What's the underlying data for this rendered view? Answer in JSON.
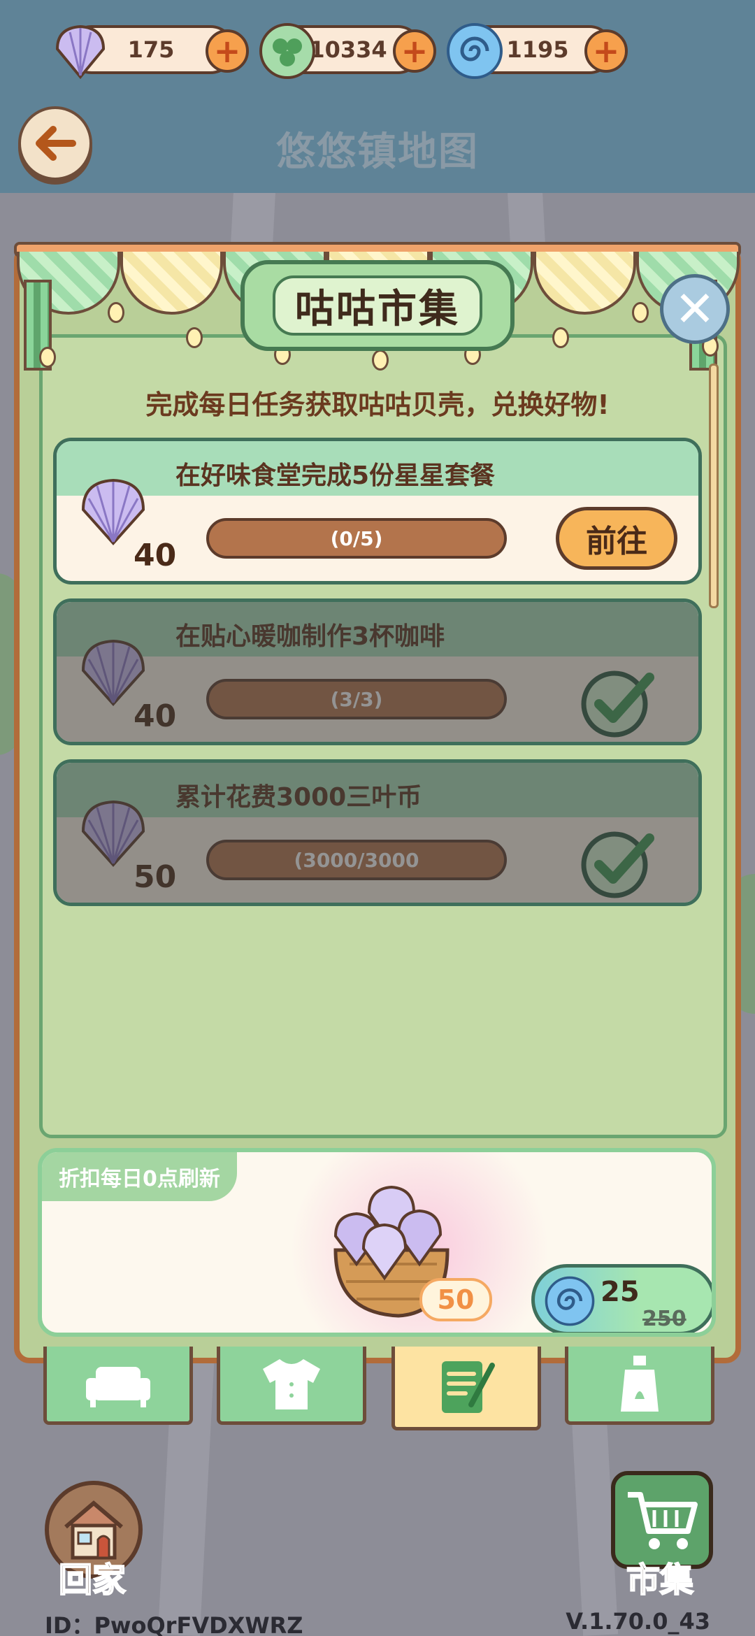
{
  "currencies": [
    {
      "name": "shell",
      "amount": "175",
      "icon": "shell-icon"
    },
    {
      "name": "clover",
      "amount": "10334",
      "icon": "clover-icon"
    },
    {
      "name": "swirl",
      "amount": "1195",
      "icon": "swirl-icon"
    }
  ],
  "header": {
    "map_title": "悠悠镇地图"
  },
  "market": {
    "title": "咕咕市集",
    "subtitle": "完成每日任务获取咕咕贝壳，兑换好物!"
  },
  "tasks": [
    {
      "title": "在好味食堂完成5份星星套餐",
      "reward": "40",
      "progress": "(0/5)",
      "action": "前往",
      "done": false
    },
    {
      "title": "在贴心暖咖制作3杯咖啡",
      "reward": "40",
      "progress": "(3/3)",
      "done": true
    },
    {
      "title": "累计花费3000三叶币",
      "reward": "50",
      "progress": "(3000/3000",
      "done": true
    }
  ],
  "discount": {
    "label": "折扣每日0点刷新",
    "quantity": "50",
    "price": "25",
    "original_price": "250"
  },
  "tabs": [
    {
      "icon": "sofa-icon",
      "active": false
    },
    {
      "icon": "shirt-icon",
      "active": false
    },
    {
      "icon": "notepad-icon",
      "active": true
    },
    {
      "icon": "bottle-icon",
      "active": false
    }
  ],
  "bottom": {
    "home_label": "回家",
    "market_label": "市集",
    "player_id": "ID：PwoQrFVDXWRZ",
    "version": "V.1.70.0_43"
  },
  "colors": {
    "topbar": "#5f8397",
    "panel_frame": "#b26c3a",
    "panel_bg": "#b9cf98",
    "accent_orange": "#f7b55a",
    "shell_purple": "#b8a6e0"
  }
}
